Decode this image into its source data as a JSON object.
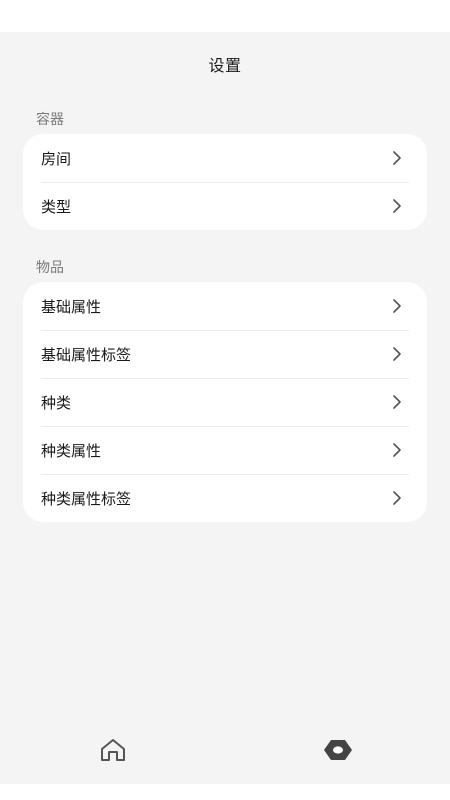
{
  "header": {
    "title": "设置"
  },
  "sections": [
    {
      "label": "容器",
      "items": [
        {
          "label": "房间"
        },
        {
          "label": "类型"
        }
      ]
    },
    {
      "label": "物品",
      "items": [
        {
          "label": "基础属性"
        },
        {
          "label": "基础属性标签"
        },
        {
          "label": "种类"
        },
        {
          "label": "种类属性"
        },
        {
          "label": "种类属性标签"
        }
      ]
    }
  ],
  "tab_bar": {
    "tabs": [
      {
        "icon": "home-icon",
        "active": false
      },
      {
        "icon": "settings-icon",
        "active": true
      }
    ]
  },
  "colors": {
    "background": "#f4f4f4",
    "card": "#ffffff",
    "section_label": "#7a7a7a",
    "chevron": "#555555",
    "icon_inactive": "#555555",
    "icon_active": "#444444"
  }
}
